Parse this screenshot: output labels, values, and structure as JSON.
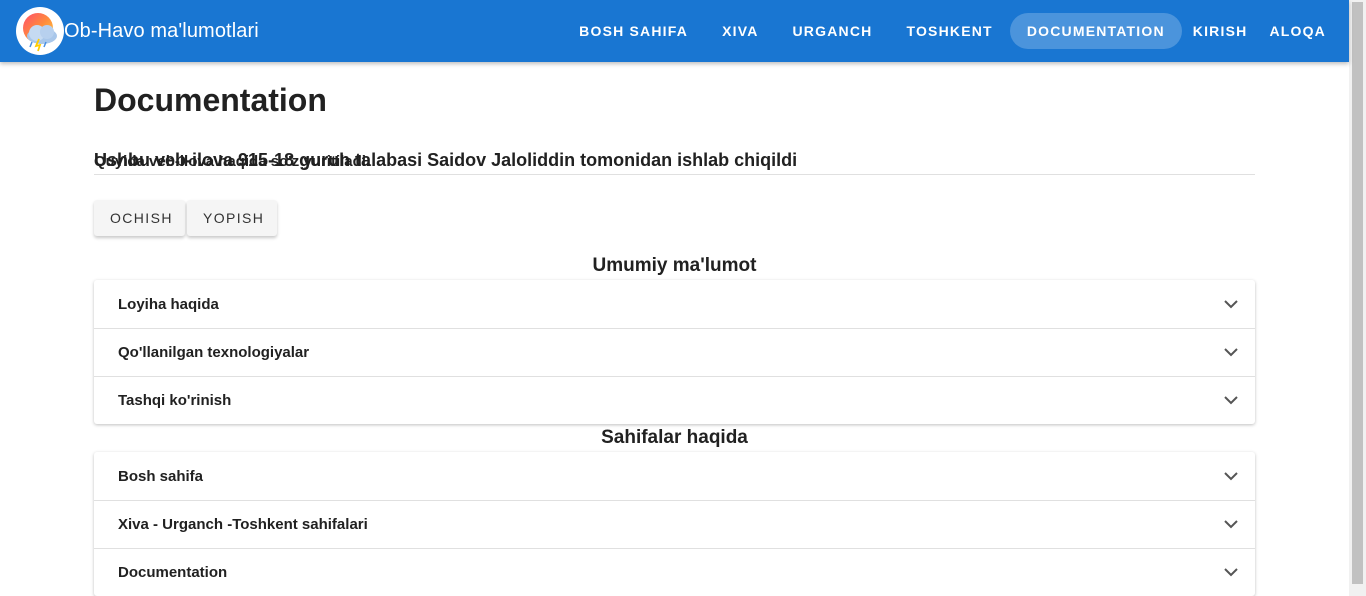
{
  "header": {
    "brand_title": "Ob-Havo ma'lumotlari",
    "nav": [
      {
        "label": "BOSH SAHIFA"
      },
      {
        "label": "XIVA"
      },
      {
        "label": "URGANCH"
      },
      {
        "label": "TOSHKENT"
      },
      {
        "label": "DOCUMENTATION",
        "active": true
      },
      {
        "label": "KIRISH"
      },
      {
        "label": "ALOQA"
      }
    ],
    "logo_icon": "weather-cloud-sun-icon"
  },
  "main": {
    "title": "Documentation",
    "subtitle": "Ushbu veb-ilova 915-18 guruh talabasi Saidov Jaloliddin tomonidan ishlab chiqildi",
    "description": "Quyida veb-ilova haqida so'z yuritiladi.",
    "buttons": {
      "open_label": "OCHISH",
      "close_label": "YOPISH"
    },
    "sections": [
      {
        "title": "Umumiy ma'lumot",
        "panels": [
          "Loyiha haqida",
          "Qo'llanilgan texnologiyalar",
          "Tashqi ko'rinish"
        ]
      },
      {
        "title": "Sahifalar haqida",
        "panels": [
          "Bosh sahifa",
          "Xiva - Urganch -Toshkent sahifalari",
          "Documentation"
        ]
      }
    ]
  },
  "colors": {
    "appbar": "#1976d2",
    "active_nav_bg": "rgba(255,255,255,0.22)",
    "text": "#212121"
  }
}
